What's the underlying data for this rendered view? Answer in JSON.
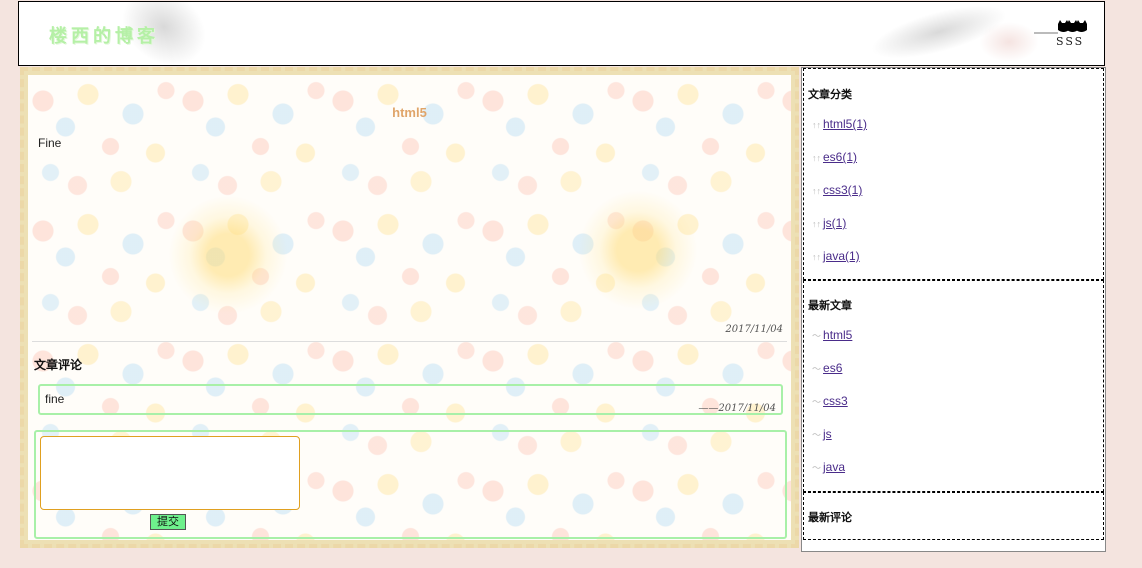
{
  "header": {
    "blog_title": "楼西的博客",
    "logo_text": "SSS"
  },
  "article": {
    "title": "html5",
    "body": "Fine",
    "date": "2017/11/04"
  },
  "comments": {
    "heading": "文章评论",
    "items": [
      {
        "text": "fine",
        "date": "——2017/11/04"
      }
    ],
    "textarea_value": "",
    "submit_label": "提交"
  },
  "sidebar": {
    "categories": {
      "heading": "文章分类",
      "items": [
        "html5(1)",
        "es6(1)",
        "css3(1)",
        "js(1)",
        "java(1)"
      ]
    },
    "latest_articles": {
      "heading": "最新文章",
      "items": [
        "html5",
        "es6",
        "css3",
        "js",
        "java"
      ]
    },
    "latest_comments": {
      "heading": "最新评论"
    }
  },
  "colors": {
    "page_background": "#f4e4df",
    "main_border": "#ecd8a8",
    "title_accent": "#e0a56a",
    "comment_border": "#a8f0a8",
    "submit_button": "#6ef08c",
    "link": "#4a2c8a",
    "blog_title": "#b5f0a6"
  }
}
